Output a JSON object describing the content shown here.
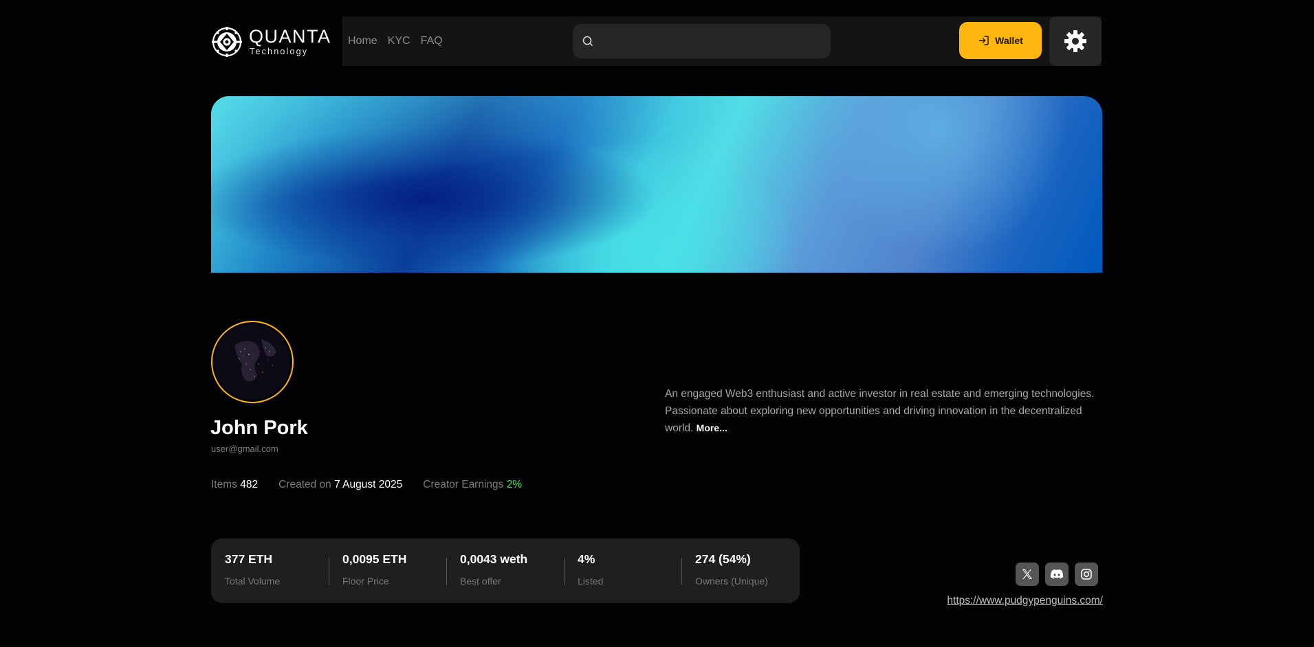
{
  "brand": {
    "name": "QUANTA",
    "tagline": "Technology"
  },
  "nav": {
    "links": [
      "Home",
      "KYC",
      "FAQ"
    ]
  },
  "search": {
    "placeholder": "",
    "value": ""
  },
  "header": {
    "wallet_label": "Wallet",
    "accent_color": "#ffb70f"
  },
  "profile": {
    "name": "John Pork",
    "email": "user@gmail.com",
    "items_label": "Items",
    "items_value": "482",
    "created_label": "Created on",
    "created_value": "7 August 2025",
    "earnings_label": "Creator Earnings",
    "earnings_value": "2%",
    "bio": "An engaged Web3 enthusiast and active investor in real estate and emerging technologies. Passionate about exploring new opportunities and driving innovation in the decentralized world.",
    "more_label": "More..."
  },
  "stats": [
    {
      "value": "377 ETH",
      "label": "Total Volume"
    },
    {
      "value": "0,0095 ETH",
      "label": "Floor Price"
    },
    {
      "value": "0,0043 weth",
      "label": "Best offer"
    },
    {
      "value": "4%",
      "label": "Listed"
    },
    {
      "value": "274 (54%)",
      "label": "Owners (Unique)"
    }
  ],
  "social": {
    "icons": [
      "x-icon",
      "discord-icon",
      "instagram-icon"
    ],
    "website": "https://www.pudgypenguins.com/"
  }
}
